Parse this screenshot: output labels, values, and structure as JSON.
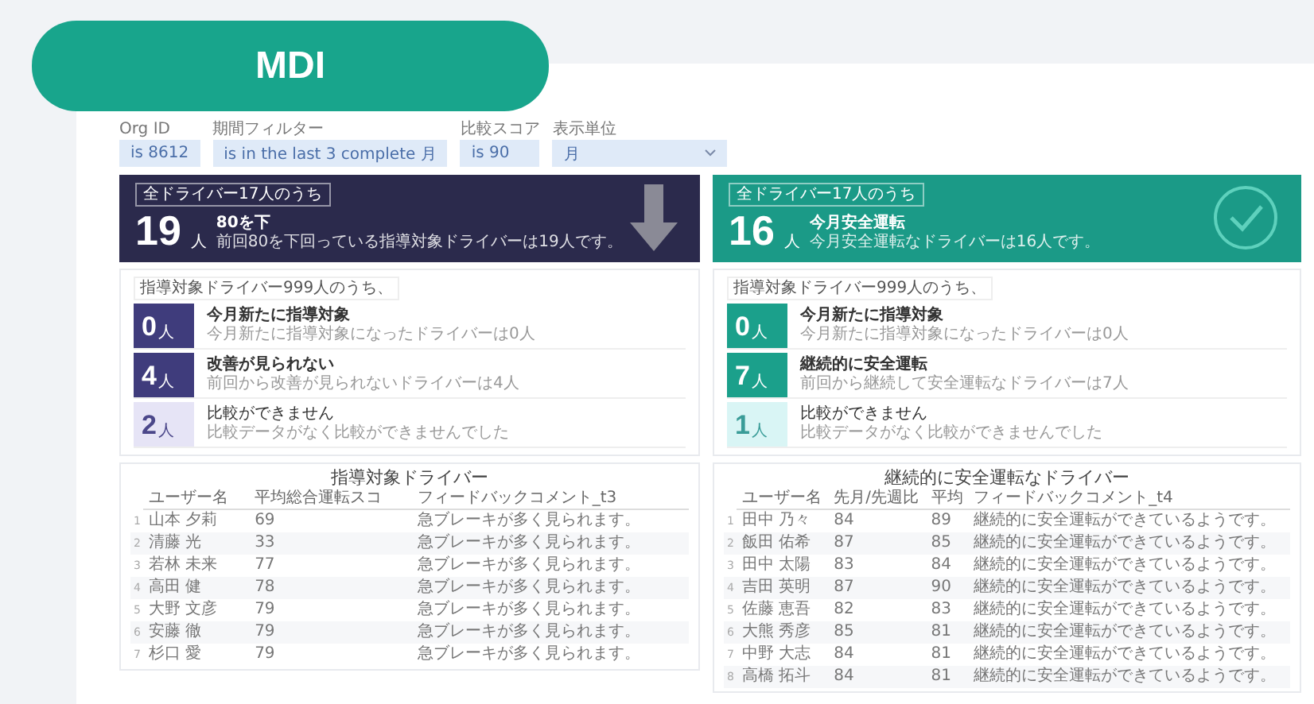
{
  "badge": "MDI",
  "filters": [
    {
      "label": "Org ID",
      "value": "is 8612",
      "kind": "text"
    },
    {
      "label": "期間フィルター",
      "value": "is in the last 3 complete 月",
      "kind": "text"
    },
    {
      "label": "比較スコア",
      "value": "is 90",
      "kind": "text"
    },
    {
      "label": "表示単位",
      "value": "月",
      "kind": "select"
    }
  ],
  "panels": [
    {
      "kind": "warning",
      "badge": "全ドライバー17人のうち",
      "count": "19",
      "unit": "人",
      "title": "80を下",
      "subtitle": "前回80を下回っている指導対象ドライバーは19人です。",
      "section_label": "指導対象ドライバー999人のうち、",
      "stats": [
        {
          "kind": "strong",
          "count": "0",
          "unit": "人",
          "title": "今月新たに指導対象",
          "subtitle": "今月新たに指導対象になったドライバーは0人"
        },
        {
          "kind": "strong",
          "count": "4",
          "unit": "人",
          "title": "改善が見られない",
          "subtitle": "前回から改善が見られないドライバーは4人"
        },
        {
          "kind": "muted",
          "count": "2",
          "unit": "人",
          "title": "比較ができません",
          "subtitle": "比較データがなく比較ができませんでした"
        }
      ],
      "table": {
        "title": "指導対象ドライバー",
        "columns": [
          "ユーザー名",
          "平均総合運転スコ",
          "フィードバックコメント_t3"
        ],
        "rows": [
          {
            "num": "1",
            "cells": [
              "山本 夕莉",
              "69",
              "急ブレーキが多く見られます。"
            ]
          },
          {
            "num": "2",
            "cells": [
              "清藤 光",
              "33",
              "急ブレーキが多く見られます。"
            ]
          },
          {
            "num": "3",
            "cells": [
              "若林 未来",
              "77",
              "急ブレーキが多く見られます。"
            ]
          },
          {
            "num": "4",
            "cells": [
              "高田 健",
              "78",
              "急ブレーキが多く見られます。"
            ]
          },
          {
            "num": "5",
            "cells": [
              "大野 文彦",
              "79",
              "急ブレーキが多く見られます。"
            ]
          },
          {
            "num": "6",
            "cells": [
              "安藤 徹",
              "79",
              "急ブレーキが多く見られます。"
            ]
          },
          {
            "num": "7",
            "cells": [
              "杉口 愛",
              "79",
              "急ブレーキが多く見られます。"
            ]
          }
        ]
      }
    },
    {
      "kind": "safe",
      "badge": "全ドライバー17人のうち",
      "count": "16",
      "unit": "人",
      "title": "今月安全運転",
      "subtitle": "今月安全運転なドライバーは16人です。",
      "section_label": "指導対象ドライバー999人のうち、",
      "stats": [
        {
          "kind": "strong",
          "count": "0",
          "unit": "人",
          "title": "今月新たに指導対象",
          "subtitle": "今月新たに指導対象になったドライバーは0人"
        },
        {
          "kind": "strong",
          "count": "7",
          "unit": "人",
          "title": "継続的に安全運転",
          "subtitle": "前回から継続して安全運転なドライバーは7人"
        },
        {
          "kind": "muted",
          "count": "1",
          "unit": "人",
          "title": "比較ができません",
          "subtitle": "比較データがなく比較ができませんでした"
        }
      ],
      "table": {
        "title": "継続的に安全運転なドライバー",
        "columns": [
          "ユーザー名",
          "先月/先週比",
          "平均",
          "フィードバックコメント_t4"
        ],
        "rows": [
          {
            "num": "1",
            "cells": [
              "田中 乃々",
              "84",
              "89",
              "継続的に安全運転ができているようです。"
            ]
          },
          {
            "num": "2",
            "cells": [
              "飯田 佑希",
              "87",
              "85",
              "継続的に安全運転ができているようです。"
            ]
          },
          {
            "num": "3",
            "cells": [
              "田中 太陽",
              "83",
              "84",
              "継続的に安全運転ができているようです。"
            ]
          },
          {
            "num": "4",
            "cells": [
              "吉田 英明",
              "87",
              "90",
              "継続的に安全運転ができているようです。"
            ]
          },
          {
            "num": "5",
            "cells": [
              "佐藤 恵吾",
              "82",
              "83",
              "継続的に安全運転ができているようです。"
            ]
          },
          {
            "num": "6",
            "cells": [
              "大熊 秀彦",
              "85",
              "81",
              "継続的に安全運転ができているようです。"
            ]
          },
          {
            "num": "7",
            "cells": [
              "中野 大志",
              "84",
              "81",
              "継続的に安全運転ができているようです。"
            ]
          },
          {
            "num": "8",
            "cells": [
              "高橋 拓斗",
              "84",
              "81",
              "継続的に安全運転ができているようです。"
            ]
          }
        ]
      }
    }
  ]
}
